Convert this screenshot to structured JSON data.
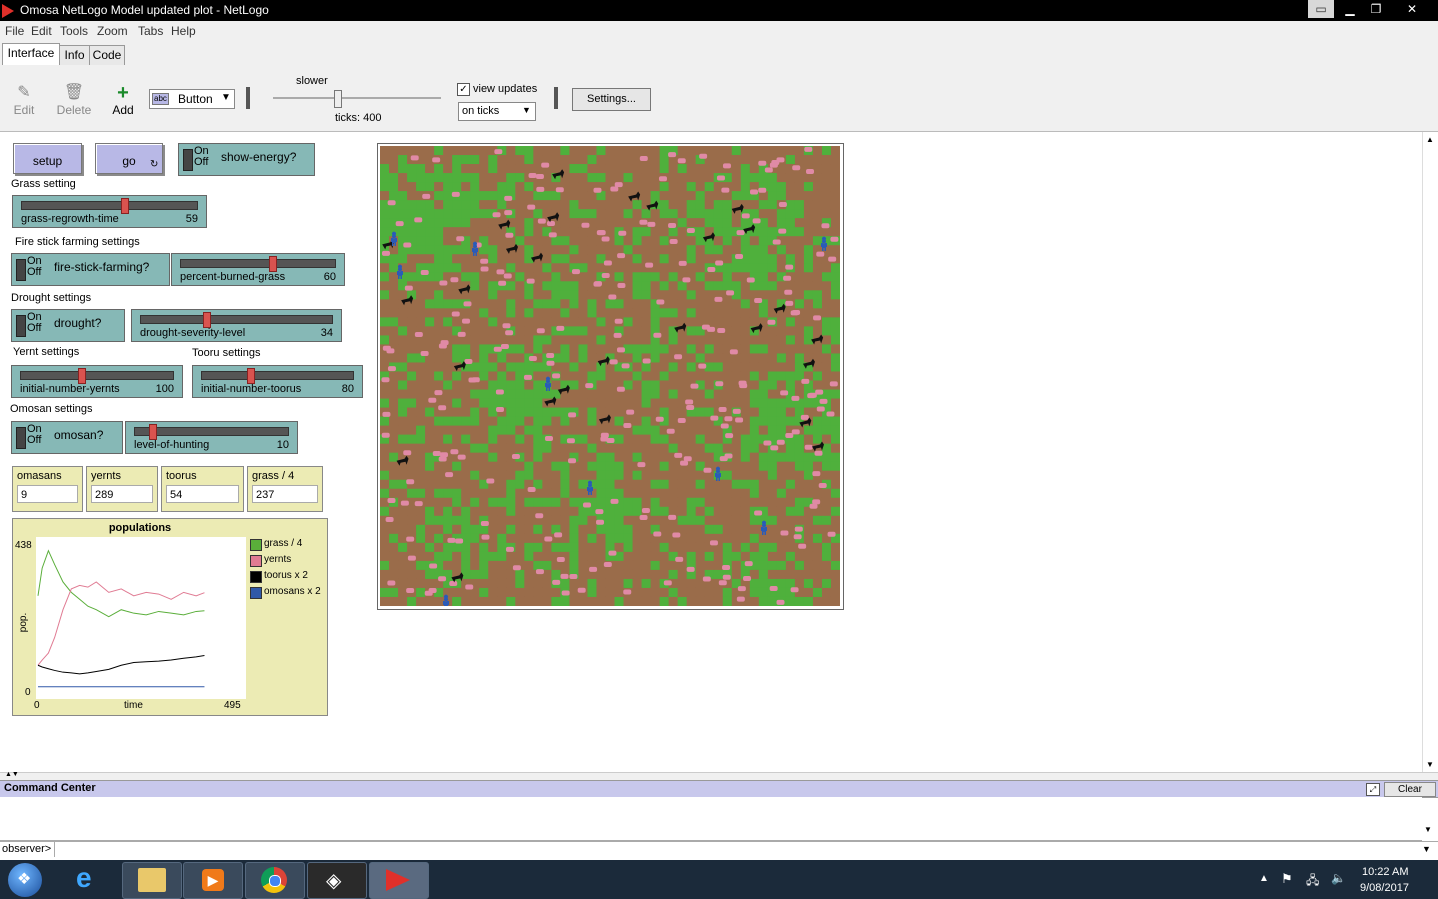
{
  "window": {
    "title": "Omosa NetLogo Model updated plot - NetLogo"
  },
  "menu": [
    "File",
    "Edit",
    "Tools",
    "Zoom",
    "Tabs",
    "Help"
  ],
  "tabs": [
    "Interface",
    "Info",
    "Code"
  ],
  "toolbar": {
    "edit": "Edit",
    "delete": "Delete",
    "add": "Add",
    "widget_type": "Button",
    "speed_label": "slower",
    "ticks": "ticks: 400",
    "view_updates": "view updates",
    "update_mode": "on ticks",
    "settings": "Settings..."
  },
  "widgets": {
    "setup": "setup",
    "go": "go",
    "on": "On",
    "off": "Off",
    "show_energy": "show-energy?",
    "grass_setting": "Grass setting",
    "grass_regrowth_time": {
      "label": "grass-regrowth-time",
      "value": "59",
      "fraction": 0.59
    },
    "fire_settings": "Fire stick farming settings",
    "fire_stick_farming": "fire-stick-farming?",
    "percent_burned_grass": {
      "label": "percent-burned-grass",
      "value": "60",
      "fraction": 0.6
    },
    "drought_settings": "Drought settings",
    "drought": "drought?",
    "drought_severity_level": {
      "label": "drought-severity-level",
      "value": "34",
      "fraction": 0.34
    },
    "yernt_settings": "Yernt settings",
    "initial_number_yernts": {
      "label": "initial-number-yernts",
      "value": "100",
      "fraction": 0.4
    },
    "tooru_settings": "Tooru settings",
    "initial_number_toorus": {
      "label": "initial-number-toorus",
      "value": "80",
      "fraction": 0.32
    },
    "omosan_settings": "Omosan settings",
    "omosan": "omosan?",
    "level_of_hunting": {
      "label": "level-of-hunting",
      "value": "10",
      "fraction": 0.1
    }
  },
  "monitors": [
    {
      "label": "omasans",
      "value": "9"
    },
    {
      "label": "yernts",
      "value": "289"
    },
    {
      "label": "toorus",
      "value": "54"
    },
    {
      "label": "grass / 4",
      "value": "237"
    }
  ],
  "chart_data": {
    "type": "line",
    "title": "populations",
    "xlabel": "time",
    "ylabel": "pop.",
    "xlim": [
      0,
      495
    ],
    "ylim": [
      0,
      438
    ],
    "x_tick_labels": [
      "0",
      "495"
    ],
    "y_tick_labels": [
      "0",
      "438"
    ],
    "legend": "right",
    "series": [
      {
        "name": "grass / 4",
        "color": "#5aae3a",
        "x": [
          0,
          10,
          25,
          40,
          60,
          80,
          100,
          120,
          140,
          170,
          200,
          230,
          260,
          290,
          320,
          350,
          380,
          400
        ],
        "y": [
          280,
          360,
          410,
          370,
          320,
          290,
          270,
          250,
          240,
          220,
          240,
          230,
          225,
          235,
          230,
          225,
          235,
          237
        ]
      },
      {
        "name": "yernts",
        "color": "#e07b93",
        "x": [
          0,
          10,
          25,
          40,
          60,
          80,
          100,
          120,
          140,
          170,
          200,
          230,
          260,
          290,
          320,
          350,
          380,
          400
        ],
        "y": [
          80,
          95,
          115,
          160,
          240,
          300,
          310,
          305,
          320,
          290,
          300,
          280,
          290,
          285,
          270,
          290,
          280,
          289
        ]
      },
      {
        "name": "toorus x 2",
        "color": "#000000",
        "x": [
          0,
          10,
          25,
          40,
          60,
          80,
          100,
          120,
          140,
          170,
          200,
          230,
          260,
          290,
          320,
          350,
          380,
          400
        ],
        "y": [
          80,
          75,
          70,
          65,
          60,
          58,
          55,
          58,
          62,
          68,
          80,
          88,
          90,
          92,
          95,
          100,
          104,
          108
        ]
      },
      {
        "name": "omosans x 2",
        "color": "#3059a8",
        "x": [
          0,
          10,
          25,
          40,
          60,
          80,
          100,
          120,
          140,
          170,
          200,
          230,
          260,
          290,
          320,
          350,
          380,
          400
        ],
        "y": [
          18,
          18,
          18,
          18,
          18,
          18,
          18,
          18,
          18,
          18,
          18,
          18,
          18,
          18,
          18,
          18,
          18,
          18
        ]
      }
    ]
  },
  "world": {
    "grass_color": "#4fb03c",
    "dirt_color": "#9a6c4a",
    "sheep_color": "#e08aa6",
    "wolf_color": "#111111",
    "person_color": "#2a5bb8"
  },
  "command_center": {
    "title": "Command Center",
    "clear": "Clear",
    "prompt": "observer>"
  },
  "taskbar": {
    "time": "10:22 AM",
    "date": "9/08/2017"
  }
}
